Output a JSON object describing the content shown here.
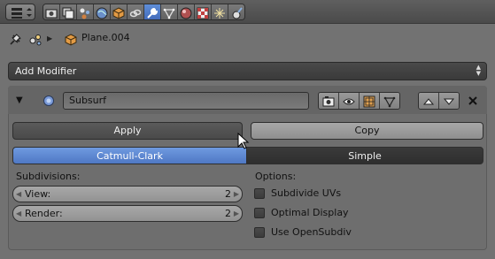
{
  "breadcrumb": {
    "object_name": "Plane.004"
  },
  "add_modifier": {
    "label": "Add Modifier"
  },
  "modifier": {
    "name": "Subsurf",
    "apply_label": "Apply",
    "copy_label": "Copy",
    "algorithm_options": [
      "Catmull-Clark",
      "Simple"
    ],
    "selected_algorithm": "Catmull-Clark",
    "subdivisions_heading": "Subdivisions:",
    "view": {
      "label": "View:",
      "value": "2"
    },
    "render": {
      "label": "Render:",
      "value": "2"
    },
    "options_heading": "Options:",
    "options": [
      {
        "label": "Subdivide UVs",
        "checked": false
      },
      {
        "label": "Optimal Display",
        "checked": false
      },
      {
        "label": "Use OpenSubdiv",
        "checked": false
      }
    ]
  },
  "colors": {
    "accent": "#5a86d4",
    "active_tab": "#4f78c4",
    "background": "#727272"
  },
  "icons": [
    "editor-type-icon",
    "render-icon",
    "render-layers-icon",
    "scene-icon",
    "world-icon",
    "object-icon",
    "constraints-icon",
    "modifiers-icon",
    "data-icon",
    "material-icon",
    "texture-icon",
    "particles-icon",
    "physics-icon",
    "pin-icon",
    "mesh-icon",
    "cube-icon",
    "camera-icon",
    "eye-icon",
    "editmode-icon",
    "cage-icon",
    "close-icon",
    "cursor-icon"
  ]
}
